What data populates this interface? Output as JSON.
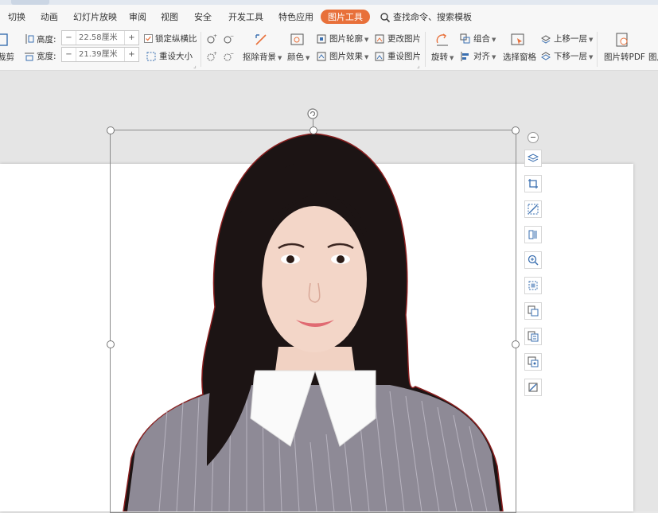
{
  "menu": {
    "items": [
      "切换",
      "动画",
      "幻灯片放映",
      "审阅",
      "视图",
      "安全",
      "开发工具",
      "特色应用"
    ],
    "active": "图片工具",
    "search": "查找命令、搜索模板"
  },
  "toolbar": {
    "crop_label": "裁剪",
    "height_label": "高度:",
    "height_value": "22.58厘米",
    "width_label": "宽度:",
    "width_value": "21.39厘米",
    "lock_ratio_label": "锁定纵横比",
    "lock_ratio_checked": true,
    "reset_size_label": "重设大小",
    "remove_bg_label": "抠除背景",
    "color_label": "颜色",
    "outline_label": "图片轮廓",
    "effect_label": "图片效果",
    "change_pic_label": "更改图片",
    "reset_pic_label": "重设图片",
    "rotate_label": "旋转",
    "group_label": "组合",
    "align_label": "对齐",
    "selection_pane_label": "选择窗格",
    "bring_forward_label": "上移一层",
    "send_backward_label": "下移一层",
    "to_pdf_label": "图片转PDF",
    "more_label": "图片",
    "minus": "−",
    "plus": "+"
  },
  "colors": {
    "accent": "#e8703a",
    "icon_blue": "#3a6fb0",
    "icon_orange": "#e8703a"
  },
  "sidebar_icons": [
    "layers-icon",
    "crop-icon",
    "remove-bg-icon",
    "replace-icon",
    "zoom-icon",
    "fit-icon",
    "convert-icon",
    "copy-text-icon",
    "export-icon",
    "format-icon"
  ]
}
